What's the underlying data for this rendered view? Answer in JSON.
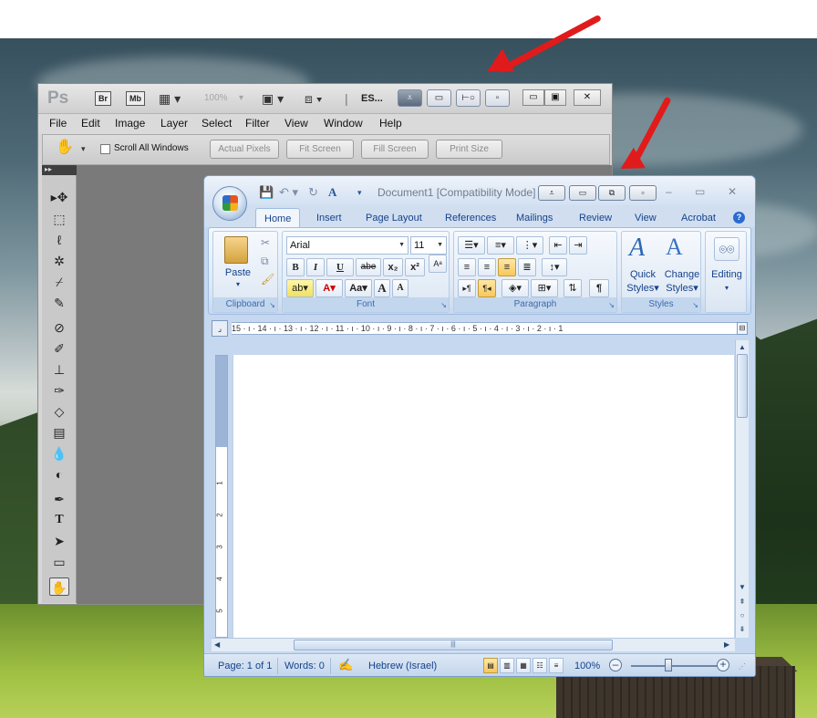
{
  "photoshop": {
    "logo": "Ps",
    "appbar": {
      "br": "Br",
      "mb": "Mb",
      "zoom": "100%",
      "workspace": "ES..."
    },
    "menus": [
      "File",
      "Edit",
      "Image",
      "Layer",
      "Select",
      "Filter",
      "View",
      "Window",
      "Help"
    ],
    "options": {
      "scroll_all_windows": "Scroll All Windows",
      "actual_pixels": "Actual Pixels",
      "fit_screen": "Fit Screen",
      "fill_screen": "Fill Screen",
      "print_size": "Print Size"
    },
    "tools": [
      "move",
      "marquee",
      "lasso",
      "quick-select",
      "crop",
      "eyedropper",
      "healing-brush",
      "brush",
      "clone-stamp",
      "history-brush",
      "eraser",
      "gradient",
      "blur",
      "dodge",
      "pen",
      "type",
      "path-select",
      "shape",
      "hand"
    ]
  },
  "word": {
    "title": "Document1 [Compatibility Mode]",
    "tabs": [
      "Home",
      "Insert",
      "Page Layout",
      "References",
      "Mailings",
      "Review",
      "View",
      "Acrobat"
    ],
    "clipboard": {
      "paste": "Paste",
      "label": "Clipboard"
    },
    "font": {
      "name": "Arial",
      "size": "11",
      "label": "Font",
      "bold": "B",
      "italic": "I",
      "underline": "U",
      "strike": "abe",
      "sub": "x₂",
      "sup": "x²",
      "change_case": "Aa",
      "grow": "A",
      "shrink": "A"
    },
    "paragraph": {
      "label": "Paragraph",
      "show_marks": "¶"
    },
    "styles": {
      "quick": "Quick",
      "quick2": "Styles",
      "change": "Change",
      "change2": "Styles",
      "label": "Styles"
    },
    "editing": {
      "label": "Editing"
    },
    "ruler_text": "15 · ı · 14 · ı · 13 · ı · 12 · ı · 11 · ı · 10 · ı · 9 · ı · 8 · ı · 7 · ı · 6 · ı · 5 · ı · 4 · ı · 3 · ı · 2 · ı · 1",
    "vruler": [
      "1",
      "2",
      "3",
      "4",
      "5"
    ],
    "status": {
      "page": "Page: 1 of 1",
      "words": "Words: 0",
      "language": "Hebrew (Israel)",
      "zoom": "100%"
    }
  },
  "colors": {
    "annotation_arrow": "#e11b1b",
    "word_frame": "#c5d8ef",
    "ps_canvas": "#7a7a7a"
  }
}
